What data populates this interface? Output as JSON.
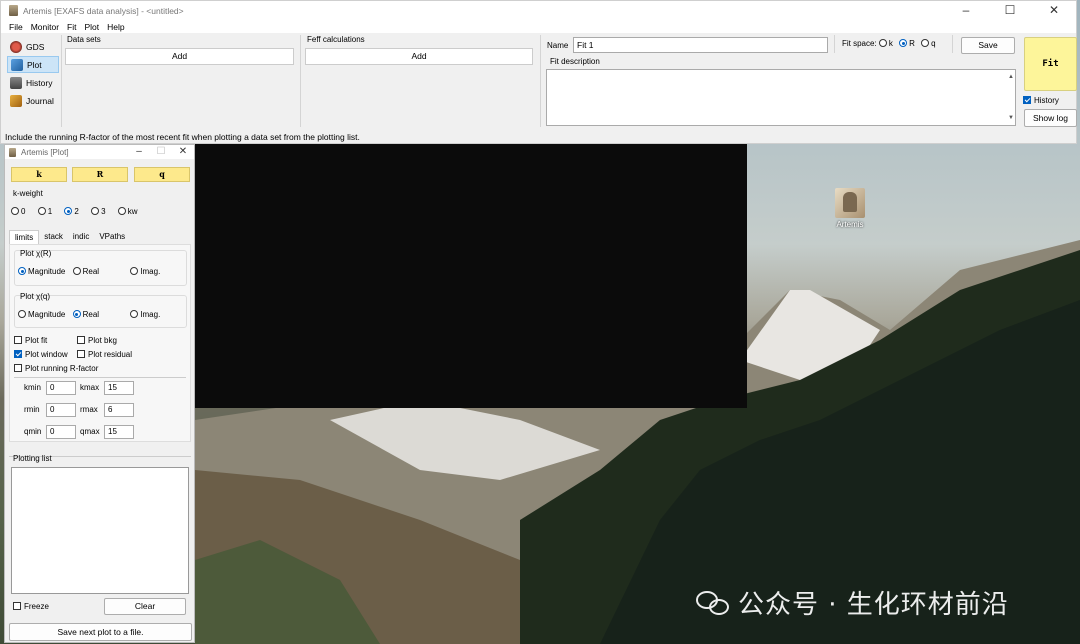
{
  "main_window": {
    "title": "Artemis [EXAFS data analysis] - <untitled>",
    "menu": [
      "File",
      "Monitor",
      "Fit",
      "Plot",
      "Help"
    ],
    "nav": [
      {
        "label": "GDS",
        "icon": "gds-icon"
      },
      {
        "label": "Plot",
        "icon": "plot-icon"
      },
      {
        "label": "History",
        "icon": "history-icon"
      },
      {
        "label": "Journal",
        "icon": "journal-icon"
      }
    ],
    "data_sets_label": "Data sets",
    "data_sets_add": "Add",
    "feff_label": "Feff calculations",
    "feff_add": "Add",
    "name_label": "Name",
    "name_value": "Fit 1",
    "fit_space_label": "Fit space:",
    "fit_space_options": [
      "k",
      "R",
      "q"
    ],
    "fit_space_selected": "R",
    "save_label": "Save",
    "fit_description_label": "Fit description",
    "fit_description_value": "",
    "fit_label": "Fit",
    "history_label": "History",
    "history_checked": true,
    "show_log_label": "Show log",
    "status_text": "Include the running R-factor of the most recent fit when plotting a data set from the plotting list."
  },
  "plot_window": {
    "title": "Artemis [Plot]",
    "plot_buttons": [
      "k",
      "R",
      "q"
    ],
    "kweight_label": "k-weight",
    "kweight_options": [
      "0",
      "1",
      "2",
      "3",
      "kw"
    ],
    "kweight_selected": "2",
    "tabs": [
      "limits",
      "stack",
      "indic",
      "VPaths"
    ],
    "active_tab": "limits",
    "plot_xr_label": "Plot χ(R)",
    "plot_xr_options": [
      "Magnitude",
      "Real",
      "Imag."
    ],
    "plot_xr_selected": "Magnitude",
    "plot_xq_label": "Plot χ(q)",
    "plot_xq_options": [
      "Magnitude",
      "Real",
      "Imag."
    ],
    "plot_xq_selected": "Real",
    "checks": {
      "plot_fit": {
        "label": "Plot fit",
        "checked": false
      },
      "plot_bkg": {
        "label": "Plot bkg",
        "checked": false
      },
      "plot_window": {
        "label": "Plot window",
        "checked": true
      },
      "plot_residual": {
        "label": "Plot residual",
        "checked": false
      },
      "plot_running_r": {
        "label": "Plot running R-factor",
        "checked": false
      }
    },
    "limits": {
      "kmin_label": "kmin",
      "kmin": "0",
      "kmax_label": "kmax",
      "kmax": "15",
      "rmin_label": "rmin",
      "rmin": "0",
      "rmax_label": "rmax",
      "rmax": "6",
      "qmin_label": "qmin",
      "qmin": "0",
      "qmax_label": "qmax",
      "qmax": "15"
    },
    "plotting_list_label": "Plotting list",
    "freeze_label": "Freeze",
    "clear_label": "Clear",
    "save_next_label": "Save next plot to a file."
  },
  "desktop": {
    "icon_label": "Artemis",
    "watermark": "公众号 · 生化环材前沿"
  }
}
